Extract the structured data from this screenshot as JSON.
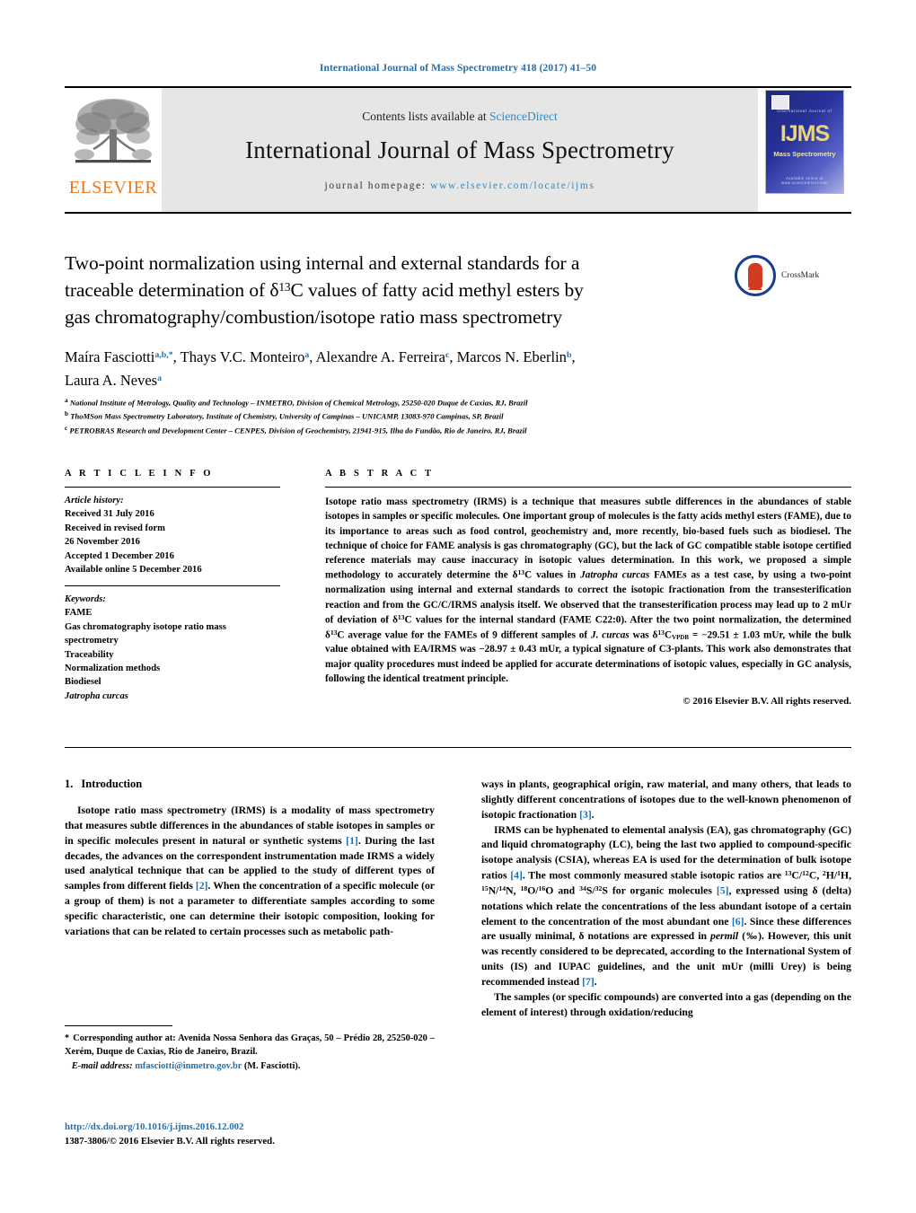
{
  "running_head": "International Journal of Mass Spectrometry 418 (2017) 41–50",
  "masthead": {
    "contents_prefix": "Contents lists available at ",
    "sciencedirect": "ScienceDirect",
    "journal_name": "International Journal of Mass Spectrometry",
    "homepage_label": "journal homepage:",
    "homepage_url": "www.elsevier.com/locate/ijms",
    "publisher_wordmark": "ELSEVIER",
    "publisher_color": "#e87722",
    "cover": {
      "mark": "IJMS",
      "subtitle": "Mass Spectrometry",
      "top_caption": "International Journal of",
      "bottom_caption": "Available online at www.sciencedirect.com"
    }
  },
  "article": {
    "title_line1": "Two-point normalization using internal and external standards for a",
    "title_line2_a": "traceable determination of ",
    "title_delta": "δ",
    "title_sup13": "13",
    "title_line2_b": "C values of fatty acid methyl esters by",
    "title_line3": "gas chromatography/combustion/isotope ratio mass spectrometry",
    "crossmark_label": "CrossMark",
    "authors": [
      {
        "name": "Maíra Fasciotti",
        "marks": "a,b,*"
      },
      {
        "name": "Thays V.C. Monteiro",
        "marks": "a"
      },
      {
        "name": "Alexandre A. Ferreira",
        "marks": "c"
      },
      {
        "name": "Marcos N. Eberlin",
        "marks": "b"
      },
      {
        "name": "Laura A. Neves",
        "marks": "a"
      }
    ],
    "affiliations": [
      {
        "mark": "a",
        "text": "National Institute of Metrology, Quality and Technology – INMETRO, Division of Chemical Metrology, 25250-020 Duque de Caxias, RJ, Brazil"
      },
      {
        "mark": "b",
        "text": "ThoMSon Mass Spectrometry Laboratory, Institute of Chemistry, University of Campinas – UNICAMP, 13083-970 Campinas, SP, Brazil"
      },
      {
        "mark": "c",
        "text": "PETROBRAS Research and Development Center – CENPES, Division of Geochemistry, 21941-915, Ilha do Fundão, Rio de Janeiro, RJ, Brazil"
      }
    ]
  },
  "article_info": {
    "heading": "A R T I C L E   I N F O",
    "history_label": "Article history:",
    "history": [
      "Received 31 July 2016",
      "Received in revised form",
      "26 November 2016",
      "Accepted 1 December 2016",
      "Available online 5 December 2016"
    ],
    "keywords_label": "Keywords:",
    "keywords": [
      "FAME",
      "Gas chromatography isotope ratio mass",
      "spectrometry",
      "Traceability",
      "Normalization methods",
      "Biodiesel"
    ],
    "keyword_italic": "Jatropha curcas"
  },
  "abstract": {
    "heading": "A B S T R A C T",
    "p1_a": "Isotope ratio mass spectrometry (IRMS) is a technique that measures subtle differences in the abundances of stable isotopes in samples or specific molecules. One important group of molecules is the fatty acids methyl esters (FAME), due to its importance to areas such as food control, geochemistry and, more recently, bio-based fuels such as biodiesel. The technique of choice for FAME analysis is gas chromatography (GC), but the lack of GC compatible stable isotope certified reference materials may cause inaccuracy in isotopic values determination. In this work, we proposed a simple methodology to accurately determine the ",
    "p1_delta1": "δ",
    "p1_sup1": "13",
    "p1_b": "C values in ",
    "p1_it1": "Jatropha curcas",
    "p1_c": " FAMEs as a test case, by using a two-point normalization using internal and external standards to correct the isotopic fractionation from the transesterification reaction and from the GC/C/IRMS analysis itself. We observed that the transesterification process may lead up to 2 mUr of deviation of ",
    "p1_delta2": "δ",
    "p1_sup2": "13",
    "p1_d": "C values for the internal standard (FAME C22:0). After the two point normalization, the determined ",
    "p1_delta3": "δ",
    "p1_sup3": "13",
    "p1_e": "C average value for the FAMEs of 9 different samples of ",
    "p1_it2": "J. curcas",
    "p1_f": " was ",
    "p1_delta4": "δ",
    "p1_sup4": "13",
    "p1_subvpdb": "VPDB",
    "p1_g": "C",
    "p1_h": " = −29.51 ± 1.03 mUr, while the bulk value obtained with EA/IRMS was −28.97 ± 0.43 mUr, a typical signature of C3-plants. This work also demonstrates that major quality procedures must indeed be applied for accurate determinations of isotopic values, especially in GC analysis, following the identical treatment principle.",
    "copyright": "© 2016 Elsevier B.V. All rights reserved."
  },
  "sections": {
    "intro_number": "1.",
    "intro_title": "Introduction",
    "left_p1_a": "Isotope ratio mass spectrometry (IRMS) is a modality of mass spectrometry that measures subtle differences in the abundances of stable isotopes in samples or in specific molecules present in natural or synthetic systems ",
    "left_p1_ref1": "[1]",
    "left_p1_b": ". During the last decades, the advances on the correspondent instrumentation made IRMS a widely used analytical technique that can be applied to the study of different types of samples from different fields ",
    "left_p1_ref2": "[2]",
    "left_p1_c": ". When the concentration of a specific molecule (or a group of them) is not a parameter to differentiate samples according to some specific characteristic, one can determine their isotopic composition, looking for variations that can be related to certain processes such as metabolic path-",
    "right_p1_a": "ways in plants, geographical origin, raw material, and many others, that leads to slightly different concentrations of isotopes due to the well-known phenomenon of isotopic fractionation ",
    "right_p1_ref3": "[3]",
    "right_p1_b": ".",
    "right_p2_a": "IRMS can be hyphenated to elemental analysis (EA), gas chromatography (GC) and liquid chromatography (LC), being the last two applied to compound-specific isotope analysis (CSIA), whereas EA is used for the determination of bulk isotope ratios ",
    "right_p2_ref4": "[4]",
    "right_p2_b": ". The most commonly measured stable isotopic ratios are ",
    "right_p2_iso1": "13",
    "right_p2_iso1b": "C/",
    "right_p2_iso2": "12",
    "right_p2_iso2b": "C, ",
    "right_p2_iso3": "2",
    "right_p2_iso3b": "H/",
    "right_p2_iso4": "1",
    "right_p2_iso4b": "H, ",
    "right_p2_iso5": "15",
    "right_p2_iso5b": "N/",
    "right_p2_iso6": "14",
    "right_p2_iso6b": "N, ",
    "right_p2_iso7": "18",
    "right_p2_iso7b": "O/",
    "right_p2_iso8": "16",
    "right_p2_iso8b": "O and ",
    "right_p2_iso9": "34",
    "right_p2_iso9b": "S/",
    "right_p2_iso10": "32",
    "right_p2_iso10b": "S for organic molecules ",
    "right_p2_ref5": "[5]",
    "right_p2_c": ", expressed using δ (delta) notations which relate the concentrations of the less abundant isotope of a certain element to the concentration of the most abundant one ",
    "right_p2_ref6": "[6]",
    "right_p2_d": ". Since these differences are usually minimal, δ notations are expressed in ",
    "right_p2_it": "permil",
    "right_p2_e": " (‰). However, this unit was recently considered to be deprecated, according to the International System of units (IS) and IUPAC guidelines, and the unit mUr (milli Urey) is being recommended instead ",
    "right_p2_ref7": "[7]",
    "right_p2_f": ".",
    "right_p3": "The samples (or specific compounds) are converted into a gas (depending on the element of interest) through oxidation/reducing"
  },
  "footer": {
    "corresponding_star": "*",
    "corresponding_text": "Corresponding author at: Avenida Nossa Senhora das Graças, 50 – Prédio 28, 25250-020 – Xerém, Duque de Caxias, Rio de Janeiro, Brazil.",
    "email_label": "E-mail address:",
    "email": "mfasciotti@inmetro.gov.br",
    "email_owner": "(M. Fasciotti).",
    "doi": "http://dx.doi.org/10.1016/j.ijms.2016.12.002",
    "issn_line": "1387-3806/© 2016 Elsevier B.V. All rights reserved."
  },
  "colors": {
    "link": "#1a72b8",
    "header_blue": "#2d6ca2",
    "elsevier_orange": "#e87722",
    "masthead_grey": "#e6e6e6"
  }
}
